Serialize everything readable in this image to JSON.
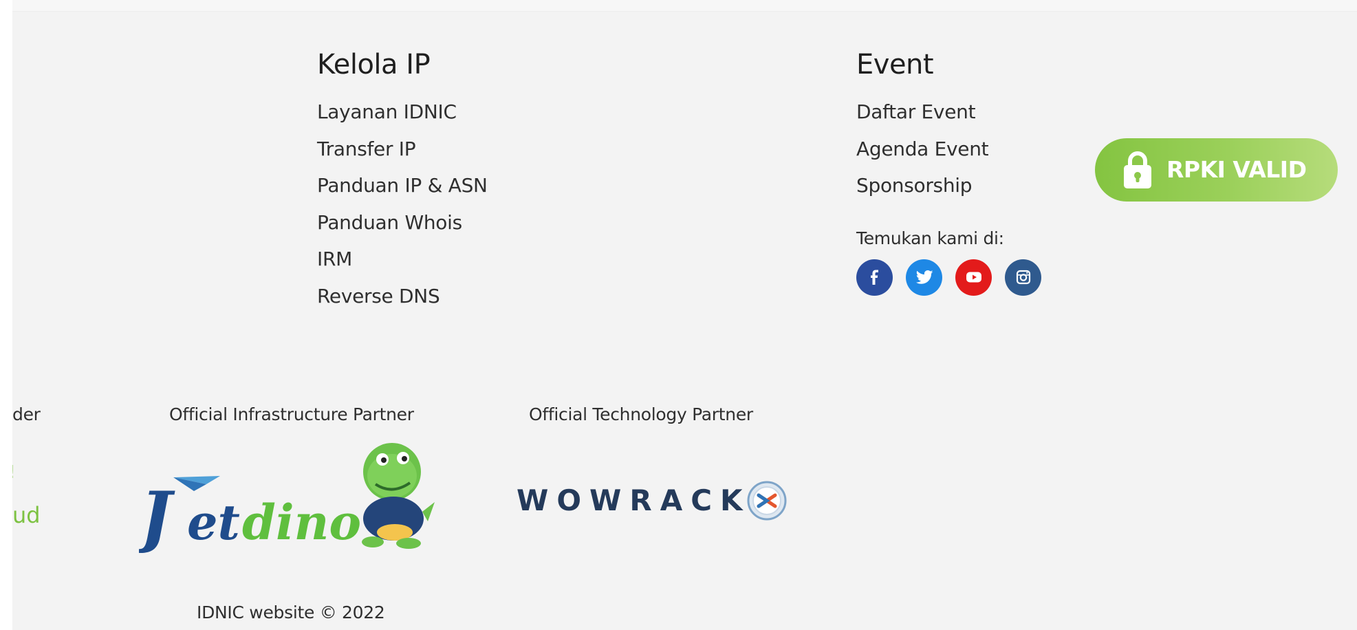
{
  "kelola": {
    "heading": "Kelola IP",
    "links": [
      "Layanan IDNIC",
      "Transfer IP",
      "Panduan IP & ASN",
      "Panduan Whois",
      "IRM",
      "Reverse DNS"
    ]
  },
  "event": {
    "heading": "Event",
    "links": [
      "Daftar Event",
      "Agenda Event",
      "Sponsorship"
    ],
    "social_label": "Temukan kami di:",
    "social": [
      {
        "icon": "facebook-icon",
        "color": "#2b4d9e"
      },
      {
        "icon": "twitter-icon",
        "color": "#1e88e5"
      },
      {
        "icon": "youtube-icon",
        "color": "#e31b1b"
      },
      {
        "icon": "instagram-icon",
        "color": "#2f5a8e"
      }
    ]
  },
  "rpki": {
    "label": "RPKI VALID",
    "color": "#84c441"
  },
  "partners": {
    "left_cut_label": "der",
    "left_cut_logo": "ud",
    "infrastructure_label": "Official Infrastructure Partner",
    "infrastructure_logo": "Jetdino",
    "technology_label": "Official Technology Partner",
    "technology_logo": "WOWRACK"
  },
  "copyright": "IDNIC website © 2022"
}
